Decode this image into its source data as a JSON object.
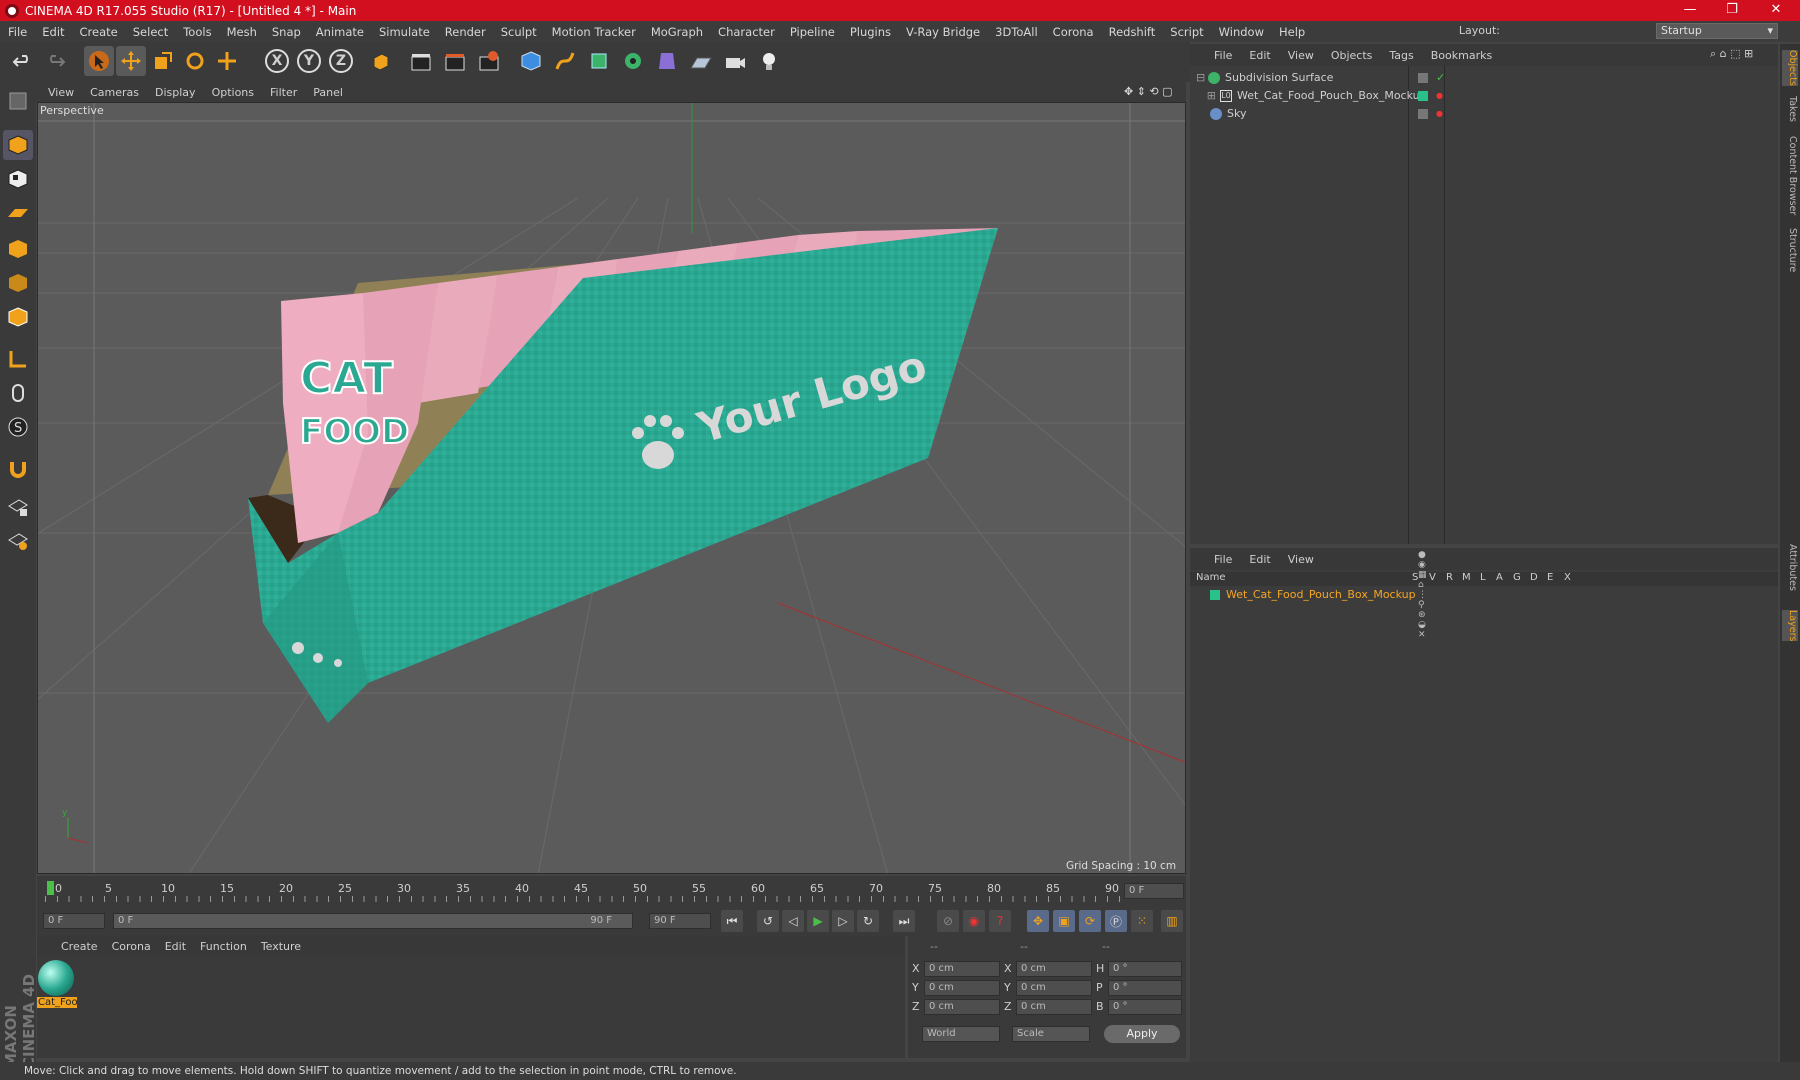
{
  "window": {
    "title": "CINEMA 4D R17.055 Studio (R17) - [Untitled 4 *] - Main",
    "min": "—",
    "max": "❐",
    "close": "✕"
  },
  "menubar": [
    "File",
    "Edit",
    "Create",
    "Select",
    "Tools",
    "Mesh",
    "Snap",
    "Animate",
    "Simulate",
    "Render",
    "Sculpt",
    "Motion Tracker",
    "MoGraph",
    "Character",
    "Pipeline",
    "Plugins",
    "V-Ray Bridge",
    "3DToAll",
    "Corona",
    "Redshift",
    "Script",
    "Window",
    "Help"
  ],
  "layout": {
    "label": "Layout:",
    "value": "Startup"
  },
  "toolbar": {
    "axis_x": "X",
    "axis_y": "Y",
    "axis_z": "Z"
  },
  "viewport": {
    "menu": [
      "View",
      "Cameras",
      "Display",
      "Options",
      "Filter",
      "Panel"
    ],
    "label": "Perspective",
    "grid_spacing": "Grid Spacing : 10 cm",
    "box_logo_text": "Your Logo",
    "pouch_text_1": "CAT",
    "pouch_text_2": "FOOD",
    "colors": {
      "box": "#2aa891",
      "pouch": "#e8a1b3",
      "bg": "#5b5b5b"
    }
  },
  "timeline": {
    "ticks": [
      "0",
      "5",
      "10",
      "15",
      "20",
      "25",
      "30",
      "35",
      "40",
      "45",
      "50",
      "55",
      "60",
      "65",
      "70",
      "75",
      "80",
      "85",
      "90"
    ],
    "end_field": "0 F"
  },
  "transport": {
    "start": "0 F",
    "range_start": "0 F",
    "range_end": "90 F",
    "end": "90 F"
  },
  "material_manager": {
    "menu": [
      "Create",
      "Corona",
      "Edit",
      "Function",
      "Texture"
    ],
    "material_name": "Cat_Foo"
  },
  "coords": {
    "header": [
      "--",
      "--",
      "--"
    ],
    "rows": [
      {
        "a": "X",
        "av": "0 cm",
        "b": "X",
        "bv": "0 cm",
        "c": "H",
        "cv": "0 °"
      },
      {
        "a": "Y",
        "av": "0 cm",
        "b": "Y",
        "bv": "0 cm",
        "c": "P",
        "cv": "0 °"
      },
      {
        "a": "Z",
        "av": "0 cm",
        "b": "Z",
        "bv": "0 cm",
        "c": "B",
        "cv": "0 °"
      }
    ],
    "world": "World",
    "scale": "Scale",
    "apply": "Apply"
  },
  "object_manager": {
    "menu": [
      "File",
      "Edit",
      "View",
      "Objects",
      "Tags",
      "Bookmarks"
    ],
    "objects": [
      "Subdivision Surface",
      "Wet_Cat_Food_Pouch_Box_Mockup",
      "Sky"
    ]
  },
  "layer_manager": {
    "menu": [
      "File",
      "Edit",
      "View"
    ],
    "columns": [
      "Name",
      "S",
      "V",
      "R",
      "M",
      "L",
      "A",
      "G",
      "D",
      "E",
      "X"
    ],
    "layer": "Wet_Cat_Food_Pouch_Box_Mockup"
  },
  "right_tabs": [
    "Objects",
    "Takes",
    "Content Browser",
    "Structure",
    "Attributes",
    "Layers"
  ],
  "status": "Move: Click and drag to move elements. Hold down SHIFT to quantize movement / add to the selection in point mode, CTRL to remove.",
  "brand": "MAXON CINEMA 4D"
}
